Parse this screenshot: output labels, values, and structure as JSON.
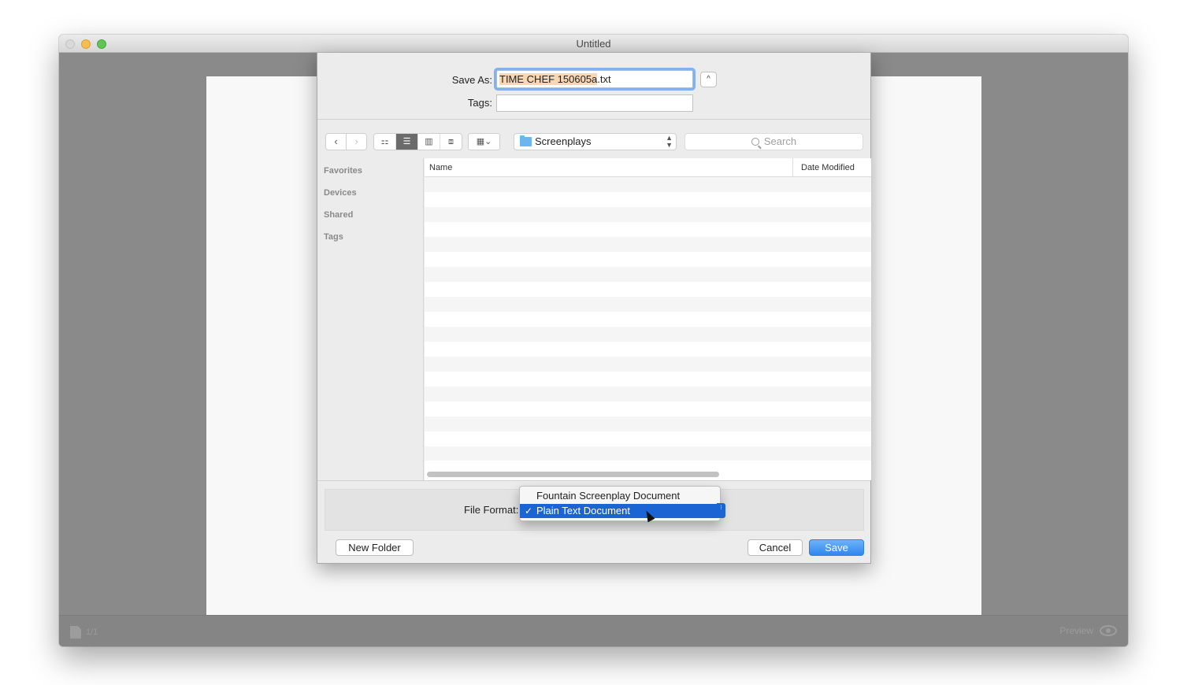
{
  "window": {
    "title": "Untitled"
  },
  "bottom_bar": {
    "page_counter": "1/1",
    "preview_label": "Preview"
  },
  "save_dialog": {
    "save_as_label": "Save As:",
    "filename_selected": "TIME CHEF 150605a",
    "filename_ext": ".txt",
    "tags_label": "Tags:",
    "tags_value": "",
    "expand_icon": "^",
    "toolbar": {
      "back_icon": "‹",
      "forward_icon": "›",
      "view_icons": [
        "⚏",
        "☰",
        "▥",
        "⧈"
      ],
      "arrange_icon": "▦⌄",
      "location": "Screenplays",
      "search_placeholder": "Search"
    },
    "sidebar": [
      "Favorites",
      "Devices",
      "Shared",
      "Tags"
    ],
    "columns": {
      "name": "Name",
      "date_modified": "Date Modified"
    },
    "file_format_label": "File Format:",
    "file_format_options": [
      "Fountain Screenplay Document",
      "Plain Text Document"
    ],
    "file_format_selected": "Plain Text Document",
    "checkmark": "✓",
    "buttons": {
      "new_folder": "New Folder",
      "cancel": "Cancel",
      "save": "Save"
    },
    "accent_color": "#1a64d4"
  }
}
